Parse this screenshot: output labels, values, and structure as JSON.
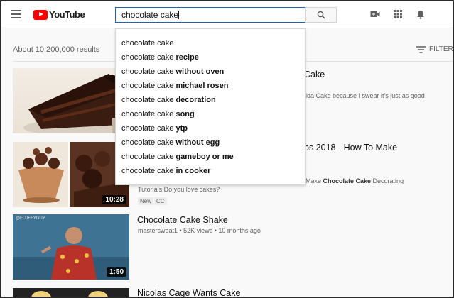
{
  "header": {
    "logo_text": "YouTube",
    "search_value": "chocolate cake"
  },
  "results": {
    "count_label": "About 10,200,000 results",
    "filter_label": "FILTER"
  },
  "suggestions": [
    {
      "prefix": "chocolate cake",
      "suffix": ""
    },
    {
      "prefix": "chocolate cake",
      "suffix": "recipe"
    },
    {
      "prefix": "chocolate cake",
      "suffix": "without oven"
    },
    {
      "prefix": "chocolate cake",
      "suffix": "michael rosen"
    },
    {
      "prefix": "chocolate cake",
      "suffix": "decoration"
    },
    {
      "prefix": "chocolate cake",
      "suffix": "song"
    },
    {
      "prefix": "chocolate cake",
      "suffix": "ytp"
    },
    {
      "prefix": "chocolate cake",
      "suffix": "without egg"
    },
    {
      "prefix": "chocolate cake",
      "suffix": "gameboy or me"
    },
    {
      "prefix": "chocolate cake",
      "suffix": "in cooker"
    }
  ],
  "videos": [
    {
      "title_tail": "Cake",
      "desc_tail": "lda Cake because I swear it's just as good",
      "duration": ""
    },
    {
      "title_tail": "os 2018 - How To Make",
      "desc_tail_pre": "Make ",
      "desc_tail_bold": "Chocolate Cake",
      "desc_tail_post": " Decorating",
      "desc_line2": "Tutorials Do you love cakes?",
      "badges": [
        "New",
        "CC"
      ],
      "duration": "10:28"
    },
    {
      "title": "Chocolate Cake Shake",
      "meta": "mastersweat1 • 52K views • 10 months ago",
      "duration": "1:50",
      "watermark": "@FLUFFYGUY"
    },
    {
      "title": "Nicolas Cage Wants Cake"
    }
  ]
}
